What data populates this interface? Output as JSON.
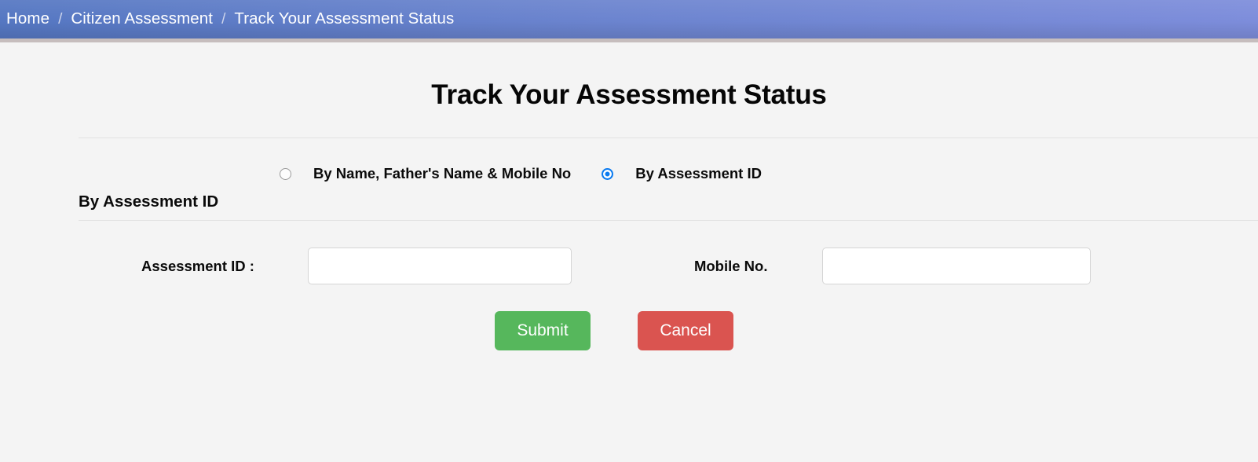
{
  "breadcrumb": {
    "separator": "/",
    "items": [
      {
        "label": "Home"
      },
      {
        "label": "Citizen Assessment"
      },
      {
        "label": "Track Your Assessment Status"
      }
    ]
  },
  "main": {
    "title": "Track Your Assessment Status",
    "search_modes": [
      {
        "label": "By Name, Father's Name & Mobile No",
        "selected": false
      },
      {
        "label": "By Assessment ID",
        "selected": true
      }
    ],
    "section_title": "By Assessment ID",
    "fields": {
      "assessment_id": {
        "label": "Assessment ID :",
        "value": "",
        "placeholder": ""
      },
      "mobile_no": {
        "label": "Mobile No.",
        "value": "",
        "placeholder": ""
      }
    },
    "actions": {
      "submit_label": "Submit",
      "cancel_label": "Cancel"
    }
  },
  "colors": {
    "breadcrumb_left": "#5577c2",
    "breadcrumb_right": "#7d8ddb",
    "breadcrumb_border": "#c6bdbd",
    "page_background": "#f4f4f4",
    "radio_selected": "#0b7bf0",
    "submit_green": "#56b75c",
    "cancel_red": "#da5450",
    "divider": "#e2e2e2"
  }
}
